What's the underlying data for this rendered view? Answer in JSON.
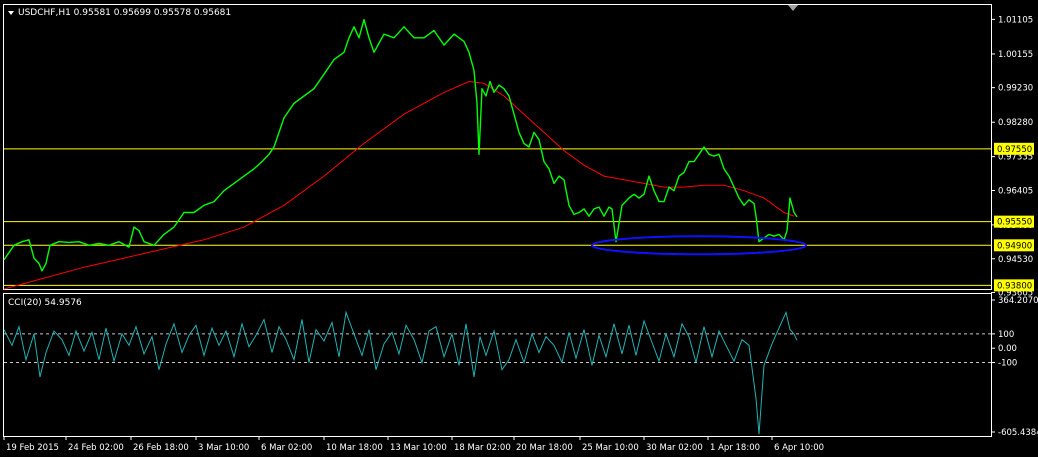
{
  "window": {
    "title": "USDCHF,H1  0.95581 0.95699 0.95578 0.95681",
    "indicator_title": "CCI(20) 54.9576"
  },
  "colors": {
    "background": "#000000",
    "price": "#00ff00",
    "ma": "#ff0000",
    "hline": "#ffff00",
    "cci": "#20b2b2",
    "ellipse": "#1010ff",
    "frame": "#ffffff"
  },
  "chart_data": [
    {
      "type": "line",
      "title": "USDCHF,H1  0.95581 0.95699 0.95578 0.95681",
      "ylim": [
        0.937,
        1.015
      ],
      "y_ticks": [
        "1.01105",
        "1.00155",
        "0.99230",
        "0.98280",
        "0.97335",
        "0.96405",
        "0.95460",
        "0.94530",
        "0.93605"
      ],
      "x_tick_labels": [
        "19 Feb 2015",
        "24 Feb 02:00",
        "26 Feb 18:00",
        "3 Mar 10:00",
        "6 Mar 02:00",
        "10 Mar 18:00",
        "13 Mar 10:00",
        "18 Mar 02:00",
        "20 Mar 18:00",
        "25 Mar 10:00",
        "30 Mar 02:00",
        "1 Apr 18:00",
        "6 Apr 10:00"
      ],
      "series": [
        {
          "role": "price",
          "x": [
            0,
            10,
            18,
            25,
            30,
            35,
            38,
            42,
            46,
            55,
            65,
            75,
            85,
            95,
            105,
            115,
            125,
            130,
            135,
            140,
            150,
            160,
            170,
            180,
            190,
            200,
            210,
            220,
            230,
            240,
            250,
            258,
            265,
            270,
            275,
            280,
            290,
            300,
            310,
            320,
            330,
            340,
            345,
            350,
            355,
            360,
            365,
            370,
            380,
            390,
            400,
            410,
            420,
            430,
            440,
            450,
            460,
            465,
            470,
            473,
            475,
            478,
            482,
            486,
            490,
            495,
            500,
            505,
            510,
            515,
            520,
            525,
            530,
            535,
            540,
            545,
            550,
            555,
            560,
            565,
            570,
            575,
            580,
            585,
            590,
            595,
            600,
            605,
            608,
            612,
            618,
            625,
            630,
            635,
            640,
            645,
            650,
            655,
            660,
            665,
            670,
            675,
            680,
            685,
            690,
            695,
            700,
            705,
            710,
            715,
            720,
            725,
            730,
            735,
            740,
            745,
            750,
            752,
            755,
            760,
            765,
            770,
            775,
            780,
            783,
            786,
            790,
            793
          ],
          "values": [
            0.945,
            0.949,
            0.95,
            0.9505,
            0.9455,
            0.944,
            0.942,
            0.944,
            0.949,
            0.95,
            0.9498,
            0.95,
            0.949,
            0.9495,
            0.949,
            0.95,
            0.9485,
            0.954,
            0.953,
            0.95,
            0.949,
            0.952,
            0.954,
            0.958,
            0.958,
            0.96,
            0.961,
            0.964,
            0.966,
            0.968,
            0.97,
            0.972,
            0.974,
            0.976,
            0.98,
            0.984,
            0.988,
            0.99,
            0.992,
            0.996,
            1.0,
            1.002,
            1.006,
            1.009,
            1.006,
            1.011,
            1.006,
            1.002,
            1.007,
            1.006,
            1.009,
            1.006,
            1.006,
            1.008,
            1.004,
            1.007,
            1.005,
            1.002,
            0.997,
            0.988,
            0.974,
            0.992,
            0.99,
            0.994,
            0.991,
            0.993,
            0.992,
            0.99,
            0.985,
            0.98,
            0.977,
            0.976,
            0.98,
            0.978,
            0.972,
            0.97,
            0.966,
            0.968,
            0.967,
            0.96,
            0.9575,
            0.958,
            0.959,
            0.957,
            0.959,
            0.9595,
            0.957,
            0.9595,
            0.959,
            0.95,
            0.96,
            0.962,
            0.963,
            0.962,
            0.963,
            0.968,
            0.964,
            0.961,
            0.961,
            0.965,
            0.964,
            0.968,
            0.969,
            0.972,
            0.972,
            0.974,
            0.976,
            0.974,
            0.9735,
            0.974,
            0.97,
            0.968,
            0.965,
            0.962,
            0.96,
            0.9615,
            0.9605,
            0.957,
            0.95,
            0.951,
            0.952,
            0.9515,
            0.952,
            0.9505,
            0.953,
            0.962,
            0.958,
            0.9568
          ]
        },
        {
          "role": "moving-average",
          "x": [
            0,
            40,
            80,
            120,
            160,
            200,
            240,
            280,
            320,
            360,
            400,
            440,
            465,
            480,
            500,
            520,
            540,
            560,
            580,
            600,
            620,
            640,
            660,
            680,
            700,
            720,
            740,
            760,
            780,
            790
          ],
          "values": [
            0.937,
            0.94,
            0.943,
            0.9455,
            0.948,
            0.9505,
            0.954,
            0.96,
            0.968,
            0.977,
            0.985,
            0.991,
            0.994,
            0.9935,
            0.99,
            0.985,
            0.98,
            0.975,
            0.971,
            0.968,
            0.967,
            0.966,
            0.965,
            0.965,
            0.9655,
            0.9655,
            0.964,
            0.962,
            0.958,
            0.957
          ]
        }
      ],
      "horizontal_lines": [
        {
          "value": 0.9755,
          "label": "0.97550"
        },
        {
          "value": 0.9555,
          "label": "0.95550"
        },
        {
          "value": 0.949,
          "label": "0.94900"
        },
        {
          "value": 0.938,
          "label": "0.93800"
        }
      ],
      "annotation_ellipse": {
        "x_range": [
          592,
          806
        ],
        "center_value": 0.949
      }
    },
    {
      "type": "line",
      "title": "CCI(20) 54.9576",
      "ylim": [
        -605.4384,
        364.207
      ],
      "y_ticks": [
        "364.2070",
        "100",
        "0.00",
        "-100",
        "-605.4384"
      ],
      "levels": [
        100,
        -100
      ],
      "series": [
        {
          "role": "cci",
          "x": [
            0,
            8,
            15,
            22,
            30,
            36,
            42,
            50,
            58,
            65,
            72,
            80,
            88,
            95,
            102,
            110,
            118,
            125,
            132,
            140,
            148,
            155,
            162,
            170,
            178,
            185,
            192,
            200,
            208,
            215,
            222,
            230,
            238,
            245,
            252,
            260,
            268,
            275,
            282,
            290,
            298,
            305,
            312,
            320,
            328,
            335,
            342,
            350,
            358,
            365,
            372,
            380,
            388,
            395,
            402,
            410,
            418,
            425,
            432,
            440,
            448,
            455,
            462,
            470,
            476,
            482,
            490,
            498,
            505,
            512,
            520,
            528,
            535,
            542,
            550,
            558,
            565,
            572,
            580,
            588,
            595,
            602,
            610,
            618,
            625,
            632,
            640,
            648,
            655,
            662,
            670,
            678,
            685,
            692,
            700,
            708,
            715,
            722,
            730,
            738,
            745,
            752,
            755,
            760,
            768,
            775,
            782,
            786,
            790,
            793
          ],
          "values": [
            130,
            20,
            150,
            -80,
            100,
            -200,
            -30,
            120,
            60,
            -50,
            120,
            -20,
            110,
            -80,
            140,
            -90,
            100,
            20,
            150,
            -40,
            80,
            -150,
            30,
            170,
            -30,
            90,
            160,
            -50,
            140,
            20,
            120,
            -60,
            170,
            10,
            90,
            200,
            -30,
            150,
            60,
            -80,
            200,
            -100,
            130,
            50,
            180,
            -60,
            250,
            100,
            -50,
            130,
            -150,
            30,
            110,
            -40,
            160,
            60,
            -100,
            120,
            150,
            -60,
            100,
            -120,
            170,
            -200,
            80,
            -50,
            120,
            -150,
            -80,
            60,
            -100,
            100,
            -30,
            80,
            20,
            -100,
            110,
            -70,
            130,
            -120,
            90,
            -60,
            170,
            -40,
            160,
            -50,
            190,
            40,
            -90,
            100,
            -60,
            170,
            80,
            -100,
            150,
            -60,
            120,
            20,
            -90,
            60,
            20,
            -350,
            -600,
            -120,
            30,
            140,
            250,
            130,
            100,
            55
          ]
        }
      ]
    }
  ],
  "labels": {
    "h_0_97550": "0.97550",
    "h_0_95550": "0.95550",
    "h_0_94900": "0.94900",
    "h_0_93800": "0.93800"
  }
}
